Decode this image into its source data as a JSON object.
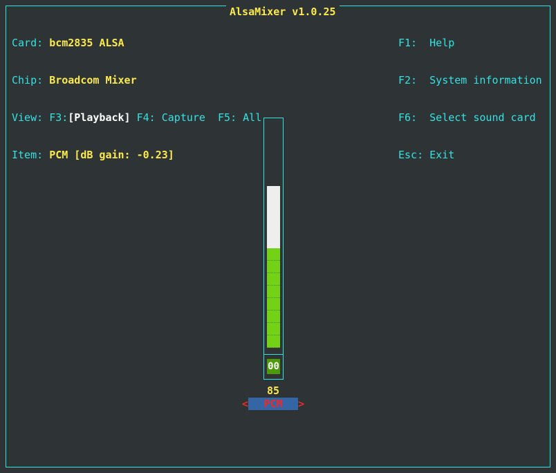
{
  "window": {
    "title": "AlsaMixer v1.0.25"
  },
  "info": {
    "card_label": "Card:",
    "card_value": "bcm2835 ALSA",
    "chip_label": "Chip:",
    "chip_value": "Broadcom Mixer",
    "view_label": "View:",
    "view_f3_key": "F3:",
    "view_f3_value": "[Playback]",
    "view_f4": "F4: Capture",
    "view_f5": "F5: All",
    "item_label": "Item:",
    "item_value": "PCM [dB gain: -0.23]"
  },
  "keys": [
    {
      "key": "F1:",
      "action": "Help"
    },
    {
      "key": "F2:",
      "action": "System information"
    },
    {
      "key": "F6:",
      "action": "Select sound card"
    },
    {
      "key": "Esc:",
      "action": "Exit"
    }
  ],
  "control": {
    "volume_value": "85",
    "volume_percent": 85,
    "mute_indicator": "00",
    "name": "PCM",
    "left_arrow": "<",
    "right_arrow": ">"
  },
  "colors": {
    "background": "#2e3436",
    "border": "#34e2e2",
    "highlight": "#fce94f",
    "meter_low": "#73d216",
    "meter_high": "#eeeeec",
    "mute": "#4e9a06",
    "selected_bg": "#3465a4",
    "selected_fg": "#ef2929"
  }
}
